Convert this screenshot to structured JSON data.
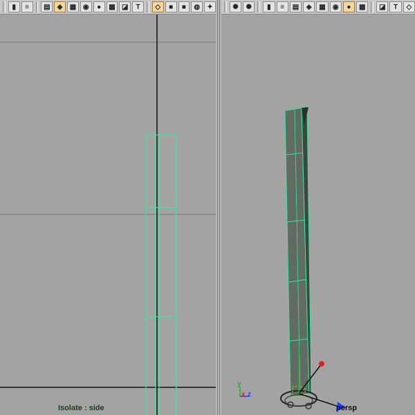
{
  "colors": {
    "viewport_bg": "#a3a3a3",
    "toolbar_bg": "#c8c8c8",
    "wireframe": "#39e6a0",
    "mesh_fill": "#5f6b63",
    "grid_line": "#7a7a7a",
    "axis_x": "#e02020",
    "axis_y": "#20b020",
    "axis_z": "#2040ff"
  },
  "left_panel": {
    "camera": "side",
    "toolbar_icons": [
      {
        "name": "bookmark-icon",
        "glyph": "▮",
        "active": false
      },
      {
        "name": "render-stack-icon",
        "glyph": "≡",
        "active": false
      },
      {
        "name": "grid-icon",
        "glyph": "▤",
        "active": false
      },
      {
        "name": "wireframe-on-shaded-icon",
        "glyph": "◈",
        "active": true
      },
      {
        "name": "film-gate-icon",
        "glyph": "▦",
        "active": false
      },
      {
        "name": "resolution-gate-icon",
        "glyph": "◉",
        "active": false
      },
      {
        "name": "lighting-sphere-icon",
        "glyph": "●",
        "active": false
      },
      {
        "name": "texture-icon",
        "glyph": "▩",
        "active": false
      },
      {
        "name": "uv-icon",
        "glyph": "◪",
        "active": false
      },
      {
        "name": "text-icon",
        "glyph": "T",
        "active": false
      },
      {
        "name": "xray-cube-icon",
        "glyph": "◇",
        "active": true
      },
      {
        "name": "shaded-cube-icon",
        "glyph": "■",
        "active": false
      },
      {
        "name": "dark-cube-icon",
        "glyph": "■",
        "active": false
      },
      {
        "name": "smooth-shade-icon",
        "glyph": "◍",
        "active": false
      },
      {
        "name": "light-bulb-icon",
        "glyph": "✦",
        "active": false
      }
    ],
    "isolate_label": "Isolate : side"
  },
  "right_panel": {
    "camera": "persp",
    "toolbar_icons": [
      {
        "name": "camera-icon",
        "glyph": "✺",
        "active": false
      },
      {
        "name": "camera-attributes-icon",
        "glyph": "✺",
        "active": false
      },
      {
        "name": "bookmark-icon",
        "glyph": "▮",
        "active": false
      },
      {
        "name": "render-stack-icon",
        "glyph": "≡",
        "active": false
      },
      {
        "name": "grid-icon",
        "glyph": "▤",
        "active": false
      },
      {
        "name": "wireframe-on-shaded-icon",
        "glyph": "◈",
        "active": false
      },
      {
        "name": "film-gate-icon",
        "glyph": "▦",
        "active": false
      },
      {
        "name": "resolution-gate-icon",
        "glyph": "◉",
        "active": false
      },
      {
        "name": "lighting-sphere-icon",
        "glyph": "●",
        "active": true
      },
      {
        "name": "texture-icon",
        "glyph": "▩",
        "active": false
      },
      {
        "name": "uv-icon",
        "glyph": "◪",
        "active": false
      },
      {
        "name": "text-icon",
        "glyph": "T",
        "active": false
      },
      {
        "name": "xray-cube-icon",
        "glyph": "◇",
        "active": false
      }
    ],
    "persp_label": "persp",
    "axis_labels": {
      "y": "y",
      "x": "x",
      "z": "z"
    }
  }
}
